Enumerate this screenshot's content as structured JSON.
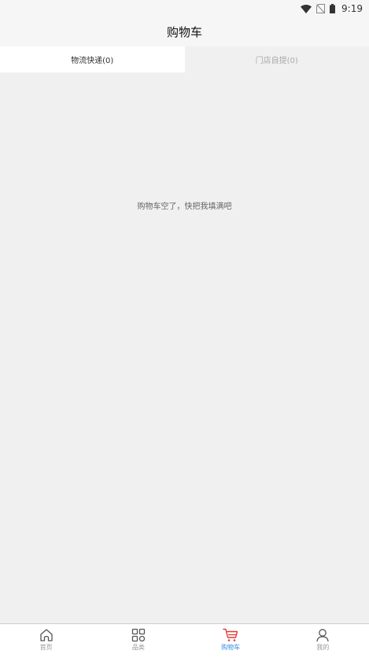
{
  "status_bar": {
    "time": "9:19",
    "icons": [
      "wifi-icon",
      "no-sim-icon",
      "battery-icon"
    ]
  },
  "header": {
    "title": "购物车"
  },
  "tabs": [
    {
      "label": "物流快递(0)",
      "active": true
    },
    {
      "label": "门店自提(0)",
      "active": false
    }
  ],
  "main": {
    "empty_message": "购物车空了，快把我填满吧"
  },
  "bottom_nav": {
    "items": [
      {
        "label": "首页",
        "icon": "home-icon",
        "active": false
      },
      {
        "label": "品类",
        "icon": "category-grid-icon",
        "active": false
      },
      {
        "label": "购物车",
        "icon": "cart-icon",
        "active": true
      },
      {
        "label": "我的",
        "icon": "user-icon",
        "active": false
      }
    ]
  },
  "colors": {
    "background": "#f0f0f0",
    "active_tab_bg": "#ffffff",
    "active_nav_text": "#3a8ee6",
    "cart_icon_accent": "#e53935",
    "inactive_text": "#999999"
  }
}
